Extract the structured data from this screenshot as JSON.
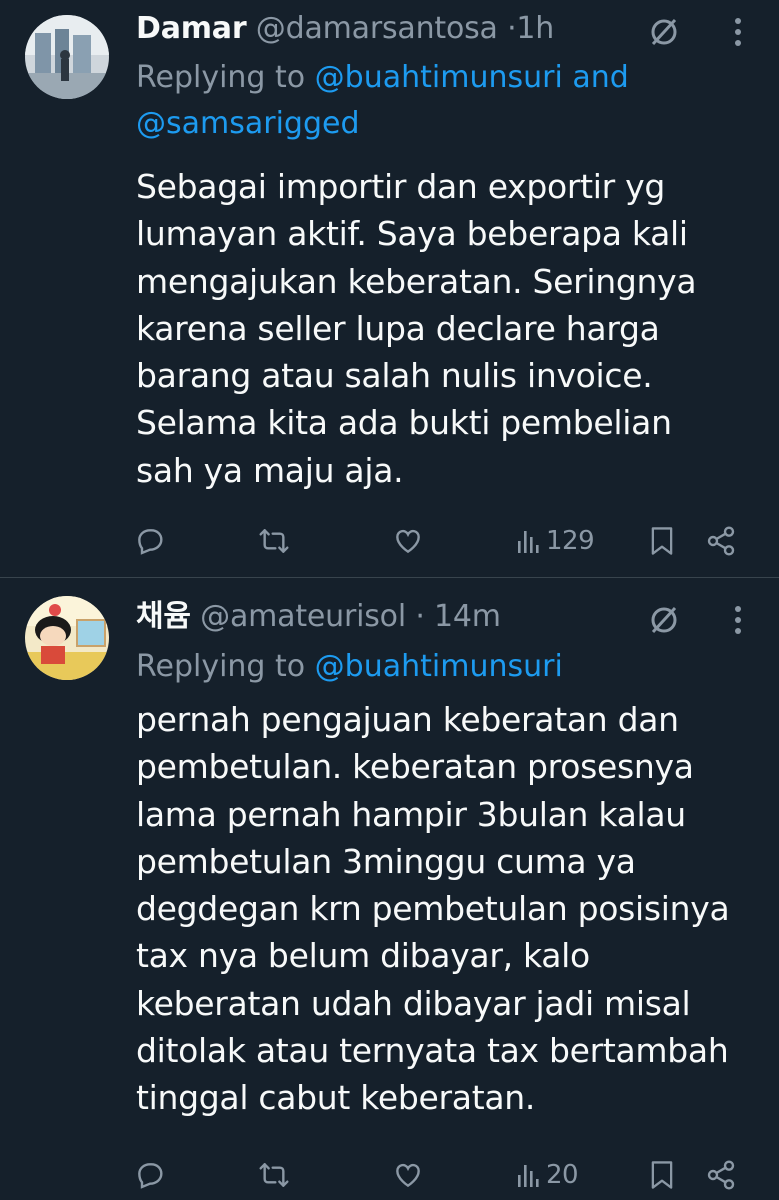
{
  "tweets": [
    {
      "name": "Damar",
      "handle": "@damarsantosa",
      "separator": "·",
      "time": "1h",
      "reply_prefix": "Replying to ",
      "reply_mentions_line1": "@buahtimunsuri and",
      "reply_mentions_line2": "@samsarigged",
      "body_lines": [
        "Sebagai importir dan exportir yg",
        "lumayan aktif. Saya beberapa kali",
        "mengajukan keberatan. Seringnya",
        "karena seller lupa declare harga",
        "barang atau salah nulis invoice.",
        "Selama kita ada bukti pembelian",
        "sah ya maju aja."
      ],
      "views": "129",
      "icons": [
        "reply-icon",
        "retweet-icon",
        "like-icon",
        "views-icon",
        "bookmark-icon",
        "share-icon"
      ]
    },
    {
      "name": "채윰",
      "handle": "@amateurisol",
      "separator": "·",
      "time": "14m",
      "reply_prefix": "Replying to ",
      "reply_mentions_line1": "@buahtimunsuri",
      "reply_mentions_line2": "",
      "body_lines": [
        "pernah pengajuan keberatan dan",
        "pembetulan. keberatan prosesnya",
        "lama pernah hampir 3bulan kalau",
        "pembetulan 3minggu cuma ya",
        "degdegan krn pembetulan posisinya",
        "tax nya belum dibayar, kalo",
        "keberatan udah dibayar jadi misal",
        "ditolak atau ternyata tax bertambah",
        "tinggal cabut keberatan."
      ],
      "views": "20",
      "icons": [
        "reply-icon",
        "retweet-icon",
        "like-icon",
        "views-icon",
        "bookmark-icon",
        "share-icon"
      ]
    }
  ],
  "colors": {
    "background": "#15202b",
    "text": "#f7f9f9",
    "secondary": "#8b98a5",
    "accent": "#1d9bf0",
    "divider": "#38444d"
  }
}
